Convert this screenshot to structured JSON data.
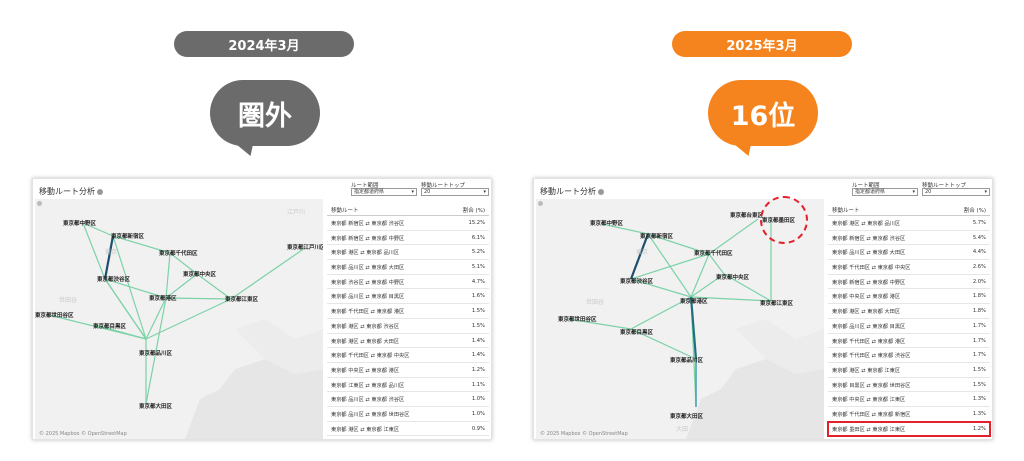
{
  "headers": {
    "left_period": "2024年3月",
    "right_period": "2025年3月",
    "left_rank": "圏外",
    "right_rank": "16位",
    "colors": {
      "gray": "#6b6b6b",
      "orange": "#f5841f",
      "highlight": "#e3212b"
    }
  },
  "panel_common": {
    "title": "移動ルート分析",
    "route_range_label": "ルート範囲",
    "route_range_value": "指定都道府県",
    "top_label": "移動ルートトップ",
    "top_value": "20",
    "col_route": "移動ルート",
    "col_ratio": "割合 (%)",
    "attribution": "© 2025 Mapbox © OpenStreetMap"
  },
  "left_panel": {
    "map_labels": [
      "東京都中野区",
      "東京都新宿区",
      "東京都千代田区",
      "東京都中央区",
      "東京都江戸川区",
      "東京都渋谷区",
      "東京都港区",
      "東京都江東区",
      "東京都世田谷区",
      "東京都目黒区",
      "東京都品川区",
      "東京都大田区"
    ],
    "map_bg_labels": [
      "東京",
      "世田谷",
      "江戸川"
    ],
    "rows": [
      {
        "route": "東京都 新宿区 ⇄ 東京都 渋谷区",
        "ratio": "15.2%"
      },
      {
        "route": "東京都 新宿区 ⇄ 東京都 中野区",
        "ratio": "6.1%"
      },
      {
        "route": "東京都 港区 ⇄ 東京都 品川区",
        "ratio": "5.2%"
      },
      {
        "route": "東京都 品川区 ⇄ 東京都 大田区",
        "ratio": "5.1%"
      },
      {
        "route": "東京都 渋谷区 ⇄ 東京都 中野区",
        "ratio": "4.7%"
      },
      {
        "route": "東京都 品川区 ⇄ 東京都 目黒区",
        "ratio": "1.6%"
      },
      {
        "route": "東京都 千代田区 ⇄ 東京都 港区",
        "ratio": "1.5%"
      },
      {
        "route": "東京都 港区 ⇄ 東京都 渋谷区",
        "ratio": "1.5%"
      },
      {
        "route": "東京都 港区 ⇄ 東京都 大田区",
        "ratio": "1.4%"
      },
      {
        "route": "東京都 千代田区 ⇄ 東京都 中央区",
        "ratio": "1.4%"
      },
      {
        "route": "東京都 中央区 ⇄ 東京都 港区",
        "ratio": "1.2%"
      },
      {
        "route": "東京都 江東区 ⇄ 東京都 品川区",
        "ratio": "1.1%"
      },
      {
        "route": "東京都 品川区 ⇄ 東京都 渋谷区",
        "ratio": "1.0%"
      },
      {
        "route": "東京都 品川区 ⇄ 東京都 世田谷区",
        "ratio": "1.0%"
      },
      {
        "route": "東京都 港区 ⇄ 東京都 江東区",
        "ratio": "0.9%"
      }
    ]
  },
  "right_panel": {
    "map_labels": [
      "東京都中野区",
      "東京都新宿区",
      "東京都台東区",
      "東京都墨田区",
      "東京都千代田区",
      "東京都中央区",
      "東京都渋谷区",
      "東京都港区",
      "東京都江東区",
      "東京都世田谷区",
      "東京都目黒区",
      "東京都品川区",
      "東京都大田区"
    ],
    "map_bg_labels": [
      "東京",
      "世田谷",
      "大田"
    ],
    "rows": [
      {
        "route": "東京都 港区 ⇄ 東京都 品川区",
        "ratio": "5.7%"
      },
      {
        "route": "東京都 新宿区 ⇄ 東京都 渋谷区",
        "ratio": "5.4%"
      },
      {
        "route": "東京都 品川区 ⇄ 東京都 大田区",
        "ratio": "4.4%"
      },
      {
        "route": "東京都 千代田区 ⇄ 東京都 中央区",
        "ratio": "2.6%"
      },
      {
        "route": "東京都 新宿区 ⇄ 東京都 中野区",
        "ratio": "2.0%"
      },
      {
        "route": "東京都 中央区 ⇄ 東京都 港区",
        "ratio": "1.8%"
      },
      {
        "route": "東京都 港区 ⇄ 東京都 大田区",
        "ratio": "1.8%"
      },
      {
        "route": "東京都 品川区 ⇄ 東京都 目黒区",
        "ratio": "1.7%"
      },
      {
        "route": "東京都 千代田区 ⇄ 東京都 港区",
        "ratio": "1.7%"
      },
      {
        "route": "東京都 千代田区 ⇄ 東京都 渋谷区",
        "ratio": "1.7%"
      },
      {
        "route": "東京都 港区 ⇄ 東京都 江東区",
        "ratio": "1.5%"
      },
      {
        "route": "東京都 目黒区 ⇄ 東京都 世田谷区",
        "ratio": "1.5%"
      },
      {
        "route": "東京都 中央区 ⇄ 東京都 江東区",
        "ratio": "1.3%"
      },
      {
        "route": "東京都 千代田区 ⇄ 東京都 新宿区",
        "ratio": "1.3%"
      },
      {
        "route": "東京都 墨田区 ⇄ 東京都 江東区",
        "ratio": "1.2%"
      }
    ]
  }
}
